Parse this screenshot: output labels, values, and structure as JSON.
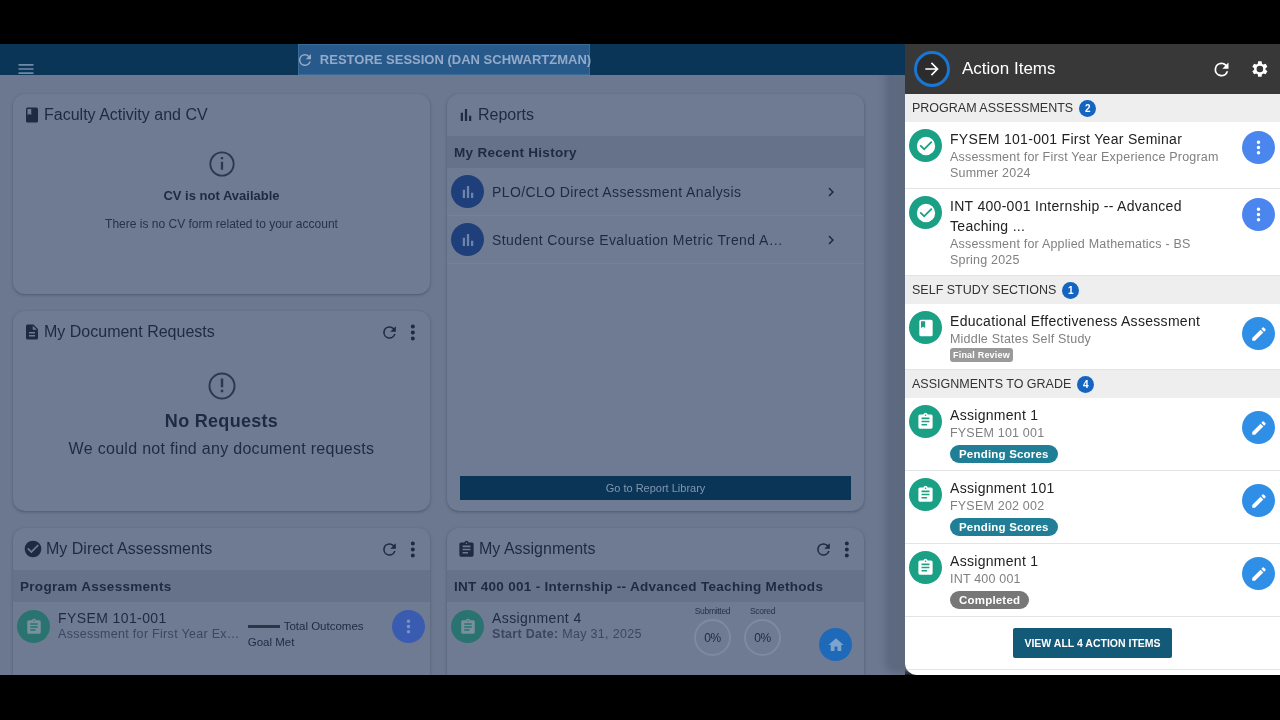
{
  "topbar": {
    "restore_button": "RESTORE SESSION (DAN SCHWARTZMAN)"
  },
  "faculty_card": {
    "title": "Faculty Activity and CV",
    "message_title": "CV is not Available",
    "message": "There is no CV form related to your account"
  },
  "document_requests_card": {
    "title": "My Document Requests",
    "empty_title": "No Requests",
    "empty_text": "We could not find any document requests"
  },
  "reports_card": {
    "title": "Reports",
    "section": "My Recent History",
    "items": [
      "PLO/CLO Direct Assessment Analysis",
      "Student Course Evaluation Metric Trend A…"
    ],
    "button": "Go to Report Library"
  },
  "direct_assessments_card": {
    "title": "My Direct Assessments",
    "section": "Program Assessments",
    "item": {
      "title": "FYSEM 101-001",
      "subtitle": "Assessment for First Year Ex…",
      "legend": "Total Outcomes",
      "goal": "Goal Met"
    }
  },
  "assignments_card": {
    "title": "My Assignments",
    "section": "INT 400 001 - Internship -- Advanced Teaching Methods",
    "item": {
      "title": "Assignment 4",
      "start": "**Start Date:** May 31, 2025",
      "stats": [
        {
          "label": "Submitted",
          "value": "0%"
        },
        {
          "label": "Scored",
          "value": "0%"
        }
      ]
    }
  },
  "action_panel": {
    "title": "Action Items",
    "sections": [
      {
        "heading": "PROGRAM ASSESSMENTS",
        "count": "2",
        "items": [
          {
            "kind": "assessment",
            "title": "FYSEM 101-001 First Year Seminar",
            "subtitle": "Assessment for First Year Experience Program",
            "term": "Summer 2024"
          },
          {
            "kind": "assessment",
            "title": "INT 400-001 Internship -- Advanced Teaching ...",
            "subtitle": "Assessment for Applied Mathematics - BS",
            "term": "Spring 2025"
          }
        ]
      },
      {
        "heading": "SELF STUDY SECTIONS",
        "count": "1",
        "items": [
          {
            "kind": "self_study",
            "title": "Educational Effectiveness Assessment",
            "subtitle": "Middle States Self Study",
            "tag": {
              "text": "Final Review",
              "kind": "small"
            }
          }
        ]
      },
      {
        "heading": "ASSIGNMENTS TO GRADE",
        "count": "4",
        "items": [
          {
            "kind": "assignment",
            "title": "Assignment 1",
            "subtitle": "FYSEM 101 001",
            "tag": {
              "text": "Pending Scores",
              "kind": "pending"
            }
          },
          {
            "kind": "assignment",
            "title": "Assignment 101",
            "subtitle": "FYSEM 202 002",
            "tag": {
              "text": "Pending Scores",
              "kind": "pending"
            }
          },
          {
            "kind": "assignment",
            "title": "Assignment 1",
            "subtitle": "INT 400 001",
            "tag": {
              "text": "Completed",
              "kind": "completed"
            }
          }
        ]
      }
    ],
    "view_all": "VIEW ALL 4 ACTION ITEMS"
  }
}
